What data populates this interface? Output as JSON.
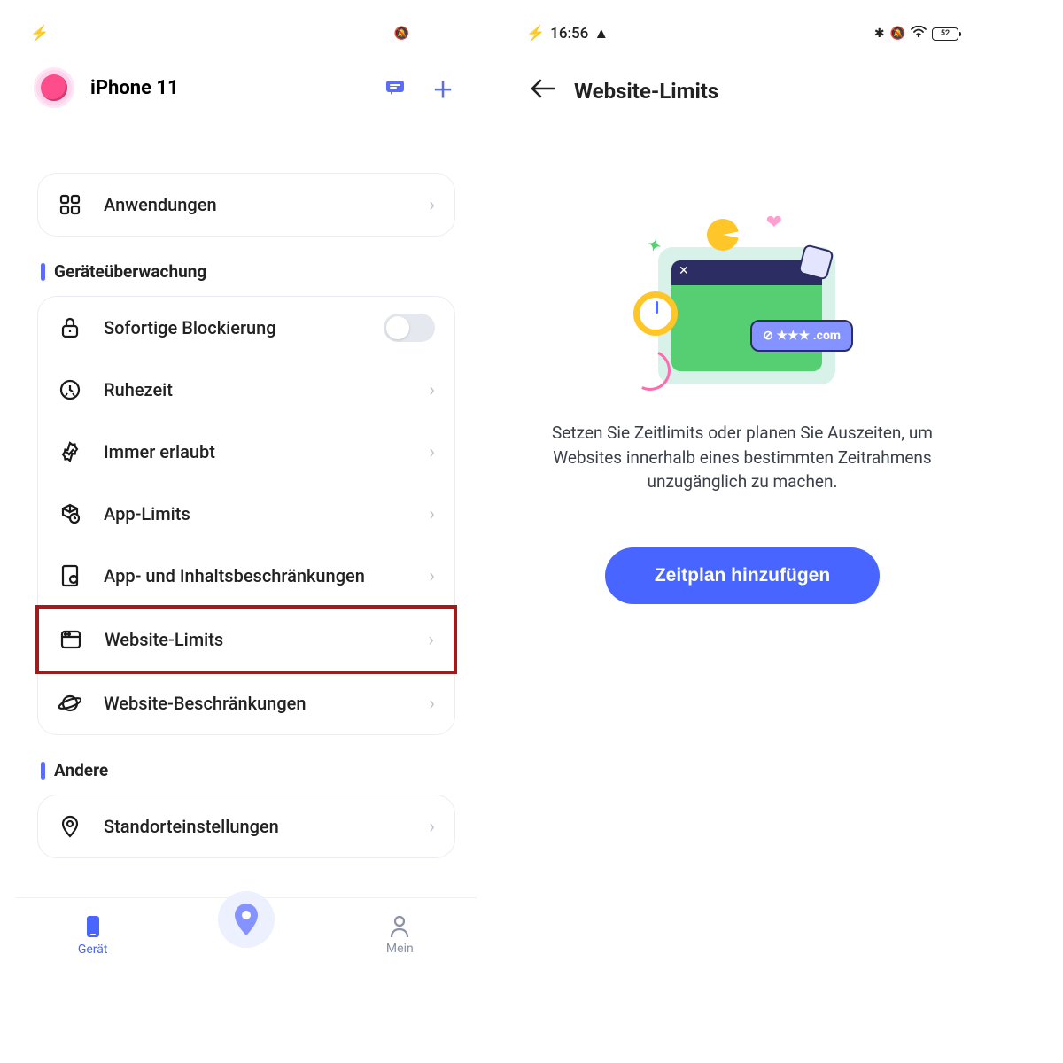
{
  "statusbar": {
    "time": "16:56",
    "battery": "52"
  },
  "left": {
    "device_name": "iPhone 11",
    "apps_row": {
      "label": "Anwendungen"
    },
    "section_monitoring": "Geräteüberwachung",
    "monitoring": [
      {
        "label": "Sofortige Blockierung",
        "toggle": true
      },
      {
        "label": "Ruhezeit"
      },
      {
        "label": "Immer erlaubt"
      },
      {
        "label": "App-Limits"
      },
      {
        "label": "App- und Inhaltsbeschränkungen"
      },
      {
        "label": "Website-Limits",
        "highlight": true
      },
      {
        "label": "Website-Beschränkungen"
      }
    ],
    "section_other": "Andere",
    "other_row": {
      "label": "Standorteinstellungen"
    },
    "nav": {
      "device": "Gerät",
      "mine": "Mein"
    }
  },
  "right": {
    "title": "Website-Limits",
    "description": "Setzen Sie Zeitlimits oder planen Sie Auszeiten, um Websites innerhalb eines bestimmten Zeitrahmens unzugänglich zu machen.",
    "button": "Zeitplan hinzufügen",
    "badge": "⊘ ★★★ .com"
  }
}
